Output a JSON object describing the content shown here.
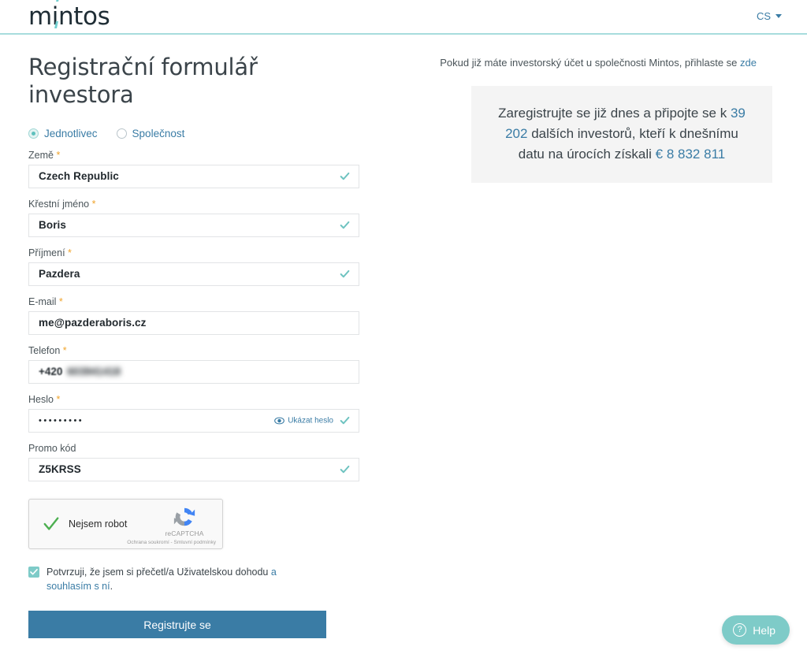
{
  "header": {
    "logo_text": "mintos",
    "logo_accent_color": "#72cfd0",
    "language": "CS",
    "language_caret_icon": "chevron-down-icon"
  },
  "page_title": "Registrační formulář investora",
  "account_type": {
    "options": [
      {
        "label": "Jednotlivec",
        "selected": true
      },
      {
        "label": "Společnost",
        "selected": false
      }
    ]
  },
  "form": {
    "required_marker": "*",
    "fields": [
      {
        "label": "Země",
        "required": true,
        "value": "Czech Republic",
        "valid": true,
        "blurred": false
      },
      {
        "label": "Křestní jméno",
        "required": true,
        "value": "Boris",
        "valid": true,
        "blurred": false
      },
      {
        "label": "Příjmení",
        "required": true,
        "value": "Pazdera",
        "valid": true,
        "blurred": false
      },
      {
        "label": "E-mail",
        "required": true,
        "value": "me@pazderaboris.cz",
        "valid": false,
        "blurred": false
      },
      {
        "label": "Telefon",
        "required": true,
        "value": "+420 603941418",
        "valid": false,
        "blurred": true
      },
      {
        "label": "Heslo",
        "required": true,
        "value": "•••••••••",
        "valid": true,
        "blurred": false
      },
      {
        "label": "Promo kód",
        "required": false,
        "value": "Z5KRSS",
        "valid": true,
        "blurred": false
      }
    ],
    "phone_prefix": "+420",
    "phone_rest": "603941418",
    "password_mask": "•••••••••",
    "show_password_label": "Ukázat heslo",
    "show_password_icon": "eye-icon",
    "valid_check_icon": "check-icon"
  },
  "recaptcha": {
    "label": "Nejsem robot",
    "checked": true,
    "check_icon": "check-icon",
    "brand": "reCAPTCHA",
    "brand_icon": "recaptcha-logo-icon",
    "terms": "Ochrana soukromí - Smluvní podmínky"
  },
  "consent": {
    "checked": true,
    "checkbox_icon": "checkbox-checked-icon",
    "text_before": "Potvrzuji, že jsem si přečetl/a Uživatelskou dohodu ",
    "link_text": "a souhlasím s ní",
    "text_after": "."
  },
  "submit": {
    "label": "Registrujte se",
    "color": "#3a7ca5"
  },
  "login_prompt": {
    "text": "Pokud již máte investorský účet u společnosti Mintos, přihlaste se ",
    "link_text": "zde"
  },
  "promo": {
    "line1": "Zaregistrujte se již dnes a připojte se k",
    "investors_count": "39 202",
    "line2_rest": " dalších investorů, kteří k",
    "line3": "dnešnímu datu na úrocích získali",
    "amount": "€ 8 832 811",
    "highlight_color": "#3a7ca5",
    "background": "#f4f4f4"
  },
  "help_widget": {
    "label": "Help",
    "icon": "question-mark-icon",
    "symbol": "?",
    "color": "#7ecbc8"
  }
}
